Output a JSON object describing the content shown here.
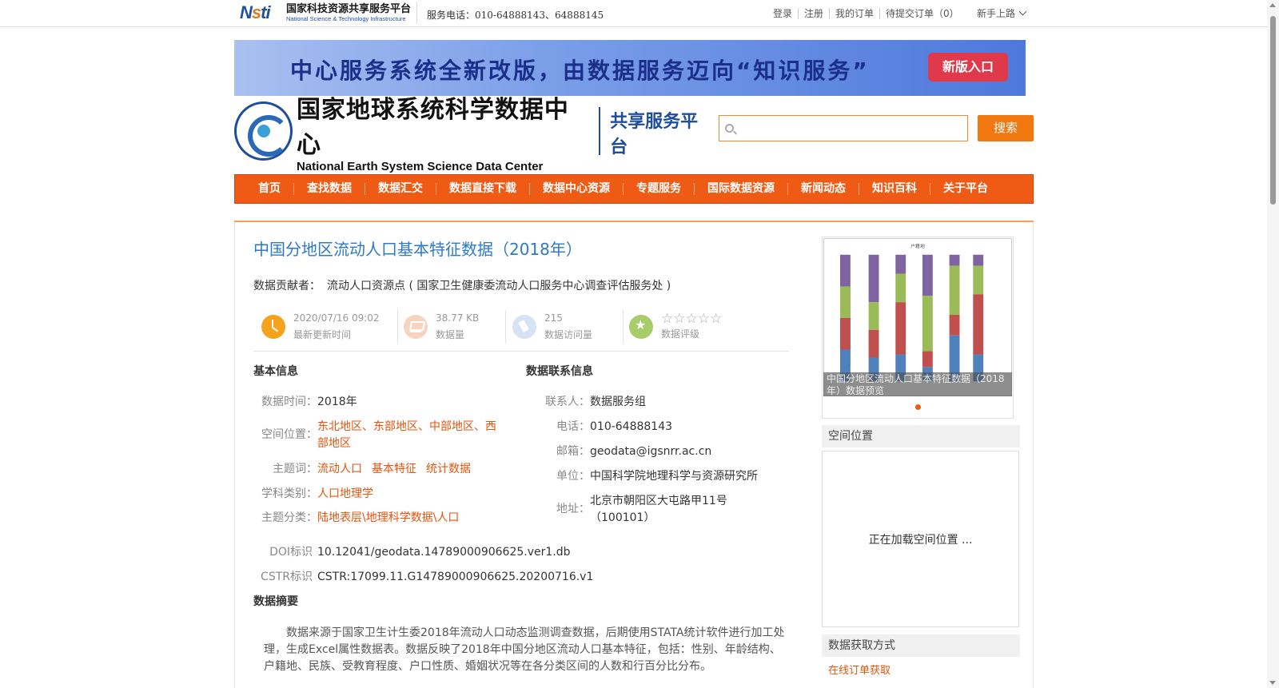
{
  "topbar": {
    "logo_cn": "国家科技资源共享服务平台",
    "logo_en": "National Science & Technology Infrastructure",
    "phone": "服务电话：010-64888143、64888145",
    "links": [
      "登录",
      "注册",
      "我的订单",
      "待提交订单（0）"
    ],
    "newbie": "新手上路"
  },
  "banner": {
    "text": "中心服务系统全新改版，由数据服务迈向“知识服务”",
    "button": "新版入口"
  },
  "header": {
    "logo_cn": "国家地球系统科学数据中心",
    "logo_en": "National Earth System Science Data Center",
    "platform": "共享服务平台",
    "search_placeholder": "",
    "search_button": "搜索"
  },
  "nav": [
    "首页",
    "查找数据",
    "数据汇交",
    "数据直接下载",
    "数据中心资源",
    "专题服务",
    "国际数据资源",
    "新闻动态",
    "知识百科",
    "关于平台"
  ],
  "dataset": {
    "title": "中国分地区流动人口基本特征数据（2018年）",
    "contributor_label": "数据贡献者：",
    "contributor": "流动人口资源点 ( 国家卫生健康委流动人口服务中心调查评估服务处 )",
    "stats": {
      "updated_value": "2020/07/16 09:02",
      "updated_label": "最新更新时间",
      "size_value": "38.77 KB",
      "size_label": "数据量",
      "visits_value": "215",
      "visits_label": "数据访问量",
      "rating_stars": "☆☆☆☆☆",
      "rating_label": "数据评级"
    },
    "basic": {
      "heading": "基本信息",
      "time_label": "数据时间：",
      "time_value": "2018年",
      "space_label": "空间位置：",
      "space_value": "东北地区、东部地区、中部地区、西部地区",
      "keywords_label": "主题词：",
      "keywords": [
        "流动人口",
        "基本特征",
        "统计数据"
      ],
      "discipline_label": "学科类别：",
      "discipline_value": "人口地理学",
      "category_label": "主题分类：",
      "category_value": "陆地表层\\地理科学数据\\人口",
      "doi_label": "DOI标识",
      "doi_value": "10.12041/geodata.14789000906625.ver1.db",
      "cstr_label": "CSTR标识",
      "cstr_value": "CSTR:17099.11.G14789000906625.20200716.v1"
    },
    "contact": {
      "heading": "数据联系信息",
      "person_label": "联系人：",
      "person_value": "数据服务组",
      "phone_label": "电话：",
      "phone_value": "010-64888143",
      "email_label": "邮箱：",
      "email_value": "geodata@igsnrr.ac.cn",
      "unit_label": "单位：",
      "unit_value": "中国科学院地理科学与资源研究所",
      "address_label": "地址：",
      "address_value": "北京市朝阳区大屯路甲11号（100101）"
    },
    "abstract_heading": "数据摘要",
    "abstract": "数据来源于国家卫生计生委2018年流动人口动态监测调查数据，后期使用STATA统计软件进行加工处理，生成Excel属性数据表。数据反映了2018年中国分地区流动人口基本特征，包括：性别、年龄结构、户籍地、民族、受教育程度、户口性质、婚姻状况等在各分类区间的人数和行百分比分布。"
  },
  "sidebar": {
    "thumb_caption": "中国分地区流动人口基本特征数据（2018年）数据预览",
    "space_heading": "空间位置",
    "map_loading": "正在加载空间位置 ...",
    "access_heading": "数据获取方式",
    "access_link": "在线订单获取"
  },
  "colors": {
    "accent": "#ef5b14",
    "title_blue": "#2e79c8",
    "link_orange": "#e5550d"
  }
}
